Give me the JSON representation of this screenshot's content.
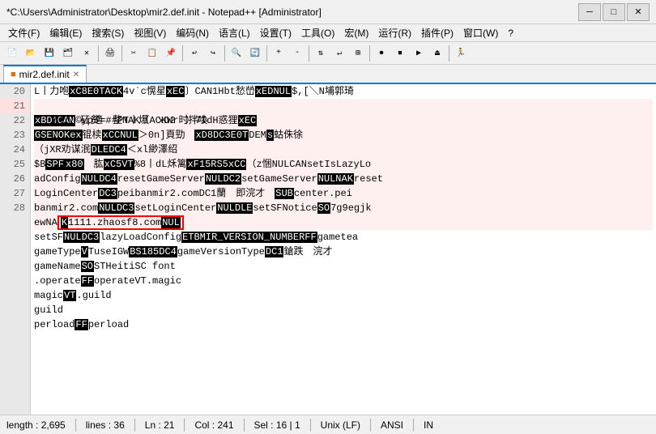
{
  "titleBar": {
    "title": "*C:\\Users\\Administrator\\Desktop\\mir2.def.init - Notepad++ [Administrator]",
    "minimizeLabel": "─",
    "maximizeLabel": "□",
    "closeLabel": "✕"
  },
  "menuBar": {
    "items": [
      "文件(F)",
      "编辑(E)",
      "搜索(S)",
      "视图(V)",
      "编码(N)",
      "语言(L)",
      "设置(T)",
      "工具(O)",
      "宏(M)",
      "运行(R)",
      "插件(P)",
      "窗口(W)",
      "?"
    ]
  },
  "tabs": [
    {
      "label": "mir2.def.init",
      "active": true,
      "modified": true
    }
  ],
  "statusBar": {
    "length": "length : 2,695",
    "lines": "lines : 36",
    "ln": "Ln : 21",
    "col": "Col : 241",
    "sel": "Sel : 16 | 1",
    "lineEnding": "Unix (LF)",
    "encoding": "ANSI",
    "ins": "IN"
  }
}
